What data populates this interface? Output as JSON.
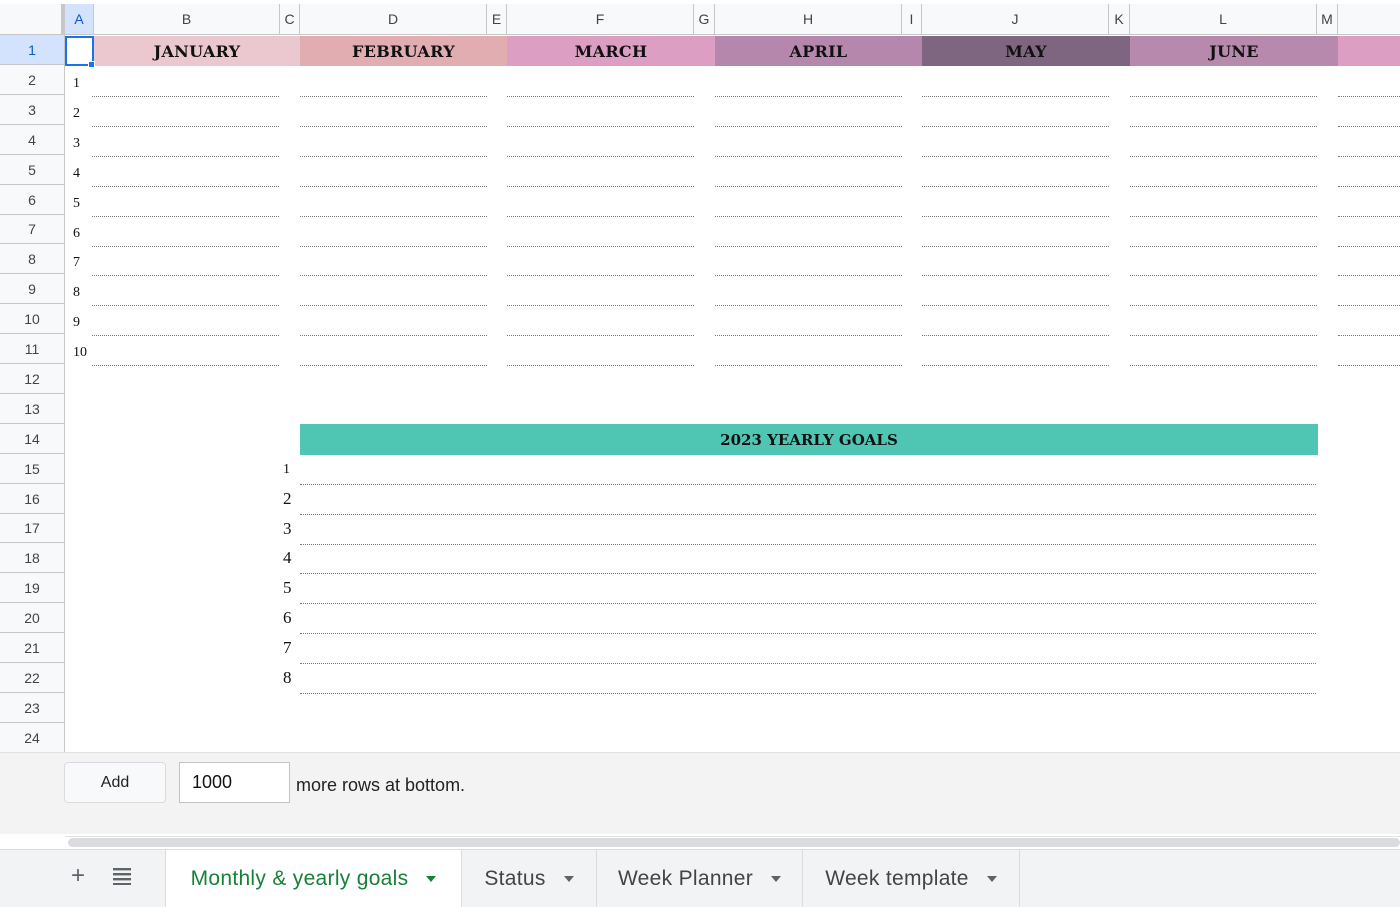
{
  "grid": {
    "columns": [
      "A",
      "B",
      "C",
      "D",
      "E",
      "F",
      "G",
      "H",
      "I",
      "J",
      "K",
      "L",
      "M"
    ],
    "rows": [
      "1",
      "2",
      "3",
      "4",
      "5",
      "6",
      "7",
      "8",
      "9",
      "10",
      "11",
      "12",
      "13",
      "14",
      "15",
      "16",
      "17",
      "18",
      "19",
      "20",
      "21",
      "22",
      "23",
      "24"
    ]
  },
  "months": [
    {
      "label": "JANUARY",
      "color": "#ebc8d0"
    },
    {
      "label": "FEBRUARY",
      "color": "#e1adb1"
    },
    {
      "label": "MARCH",
      "color": "#dd9ec4"
    },
    {
      "label": "APRIL",
      "color": "#b687ad"
    },
    {
      "label": "MAY",
      "color": "#7f6680"
    },
    {
      "label": "JUNE",
      "color": "#b689ad"
    }
  ],
  "month_overflow_color": "#dd9ec4",
  "monthly_numbers": [
    "1",
    "2",
    "3",
    "4",
    "5",
    "6",
    "7",
    "8",
    "9",
    "10"
  ],
  "yearly_goals": {
    "title": "2023 YEARLY GOALS",
    "color": "#4fc6b4",
    "numbers": [
      "1",
      "2",
      "3",
      "4",
      "5",
      "6",
      "7",
      "8"
    ]
  },
  "add_rows": {
    "button": "Add",
    "count": "1000",
    "suffix": "more rows at bottom."
  },
  "sheet_tabs": {
    "add_icon": "plus-icon",
    "list_icon": "list-icon",
    "tabs": [
      {
        "label": "Monthly & yearly goals",
        "active": true
      },
      {
        "label": "Status",
        "active": false
      },
      {
        "label": "Week Planner",
        "active": false
      },
      {
        "label": "Week template",
        "active": false
      }
    ]
  }
}
